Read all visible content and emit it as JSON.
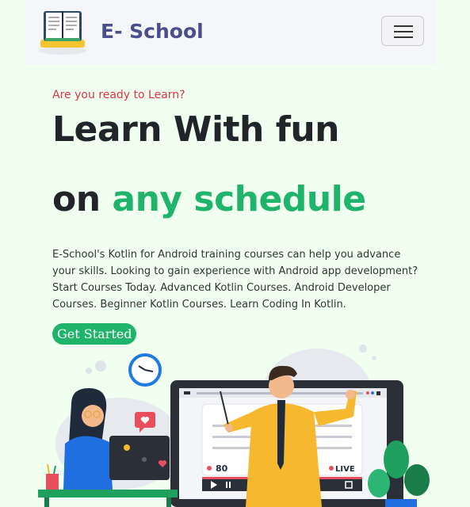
{
  "navbar": {
    "brand_name": "E- School",
    "logo_icon": "open-book-icon",
    "menu_icon": "hamburger-menu-icon"
  },
  "hero": {
    "eyebrow": "Are you ready to Learn?",
    "title_line1": "Learn With fun",
    "title_line2_prefix": "on ",
    "title_line2_accent": "any schedule",
    "description": "E-School's Kotlin for Android training courses can help you advance your skills. Looking to gain experience with Android app development? Start Courses Today. Advanced Kotlin Courses. Android Developer Courses. Beginner Kotlin Courses. Learn Coding In Kotlin.",
    "cta_label": "Get Started"
  },
  "illustration": {
    "likes_count": "80",
    "live_label": "LIVE"
  },
  "colors": {
    "page_bg": "#f0fff0",
    "accent_green": "#20b46a",
    "brand_purple": "#4a4e8c",
    "eyebrow_red": "#dc3545"
  }
}
